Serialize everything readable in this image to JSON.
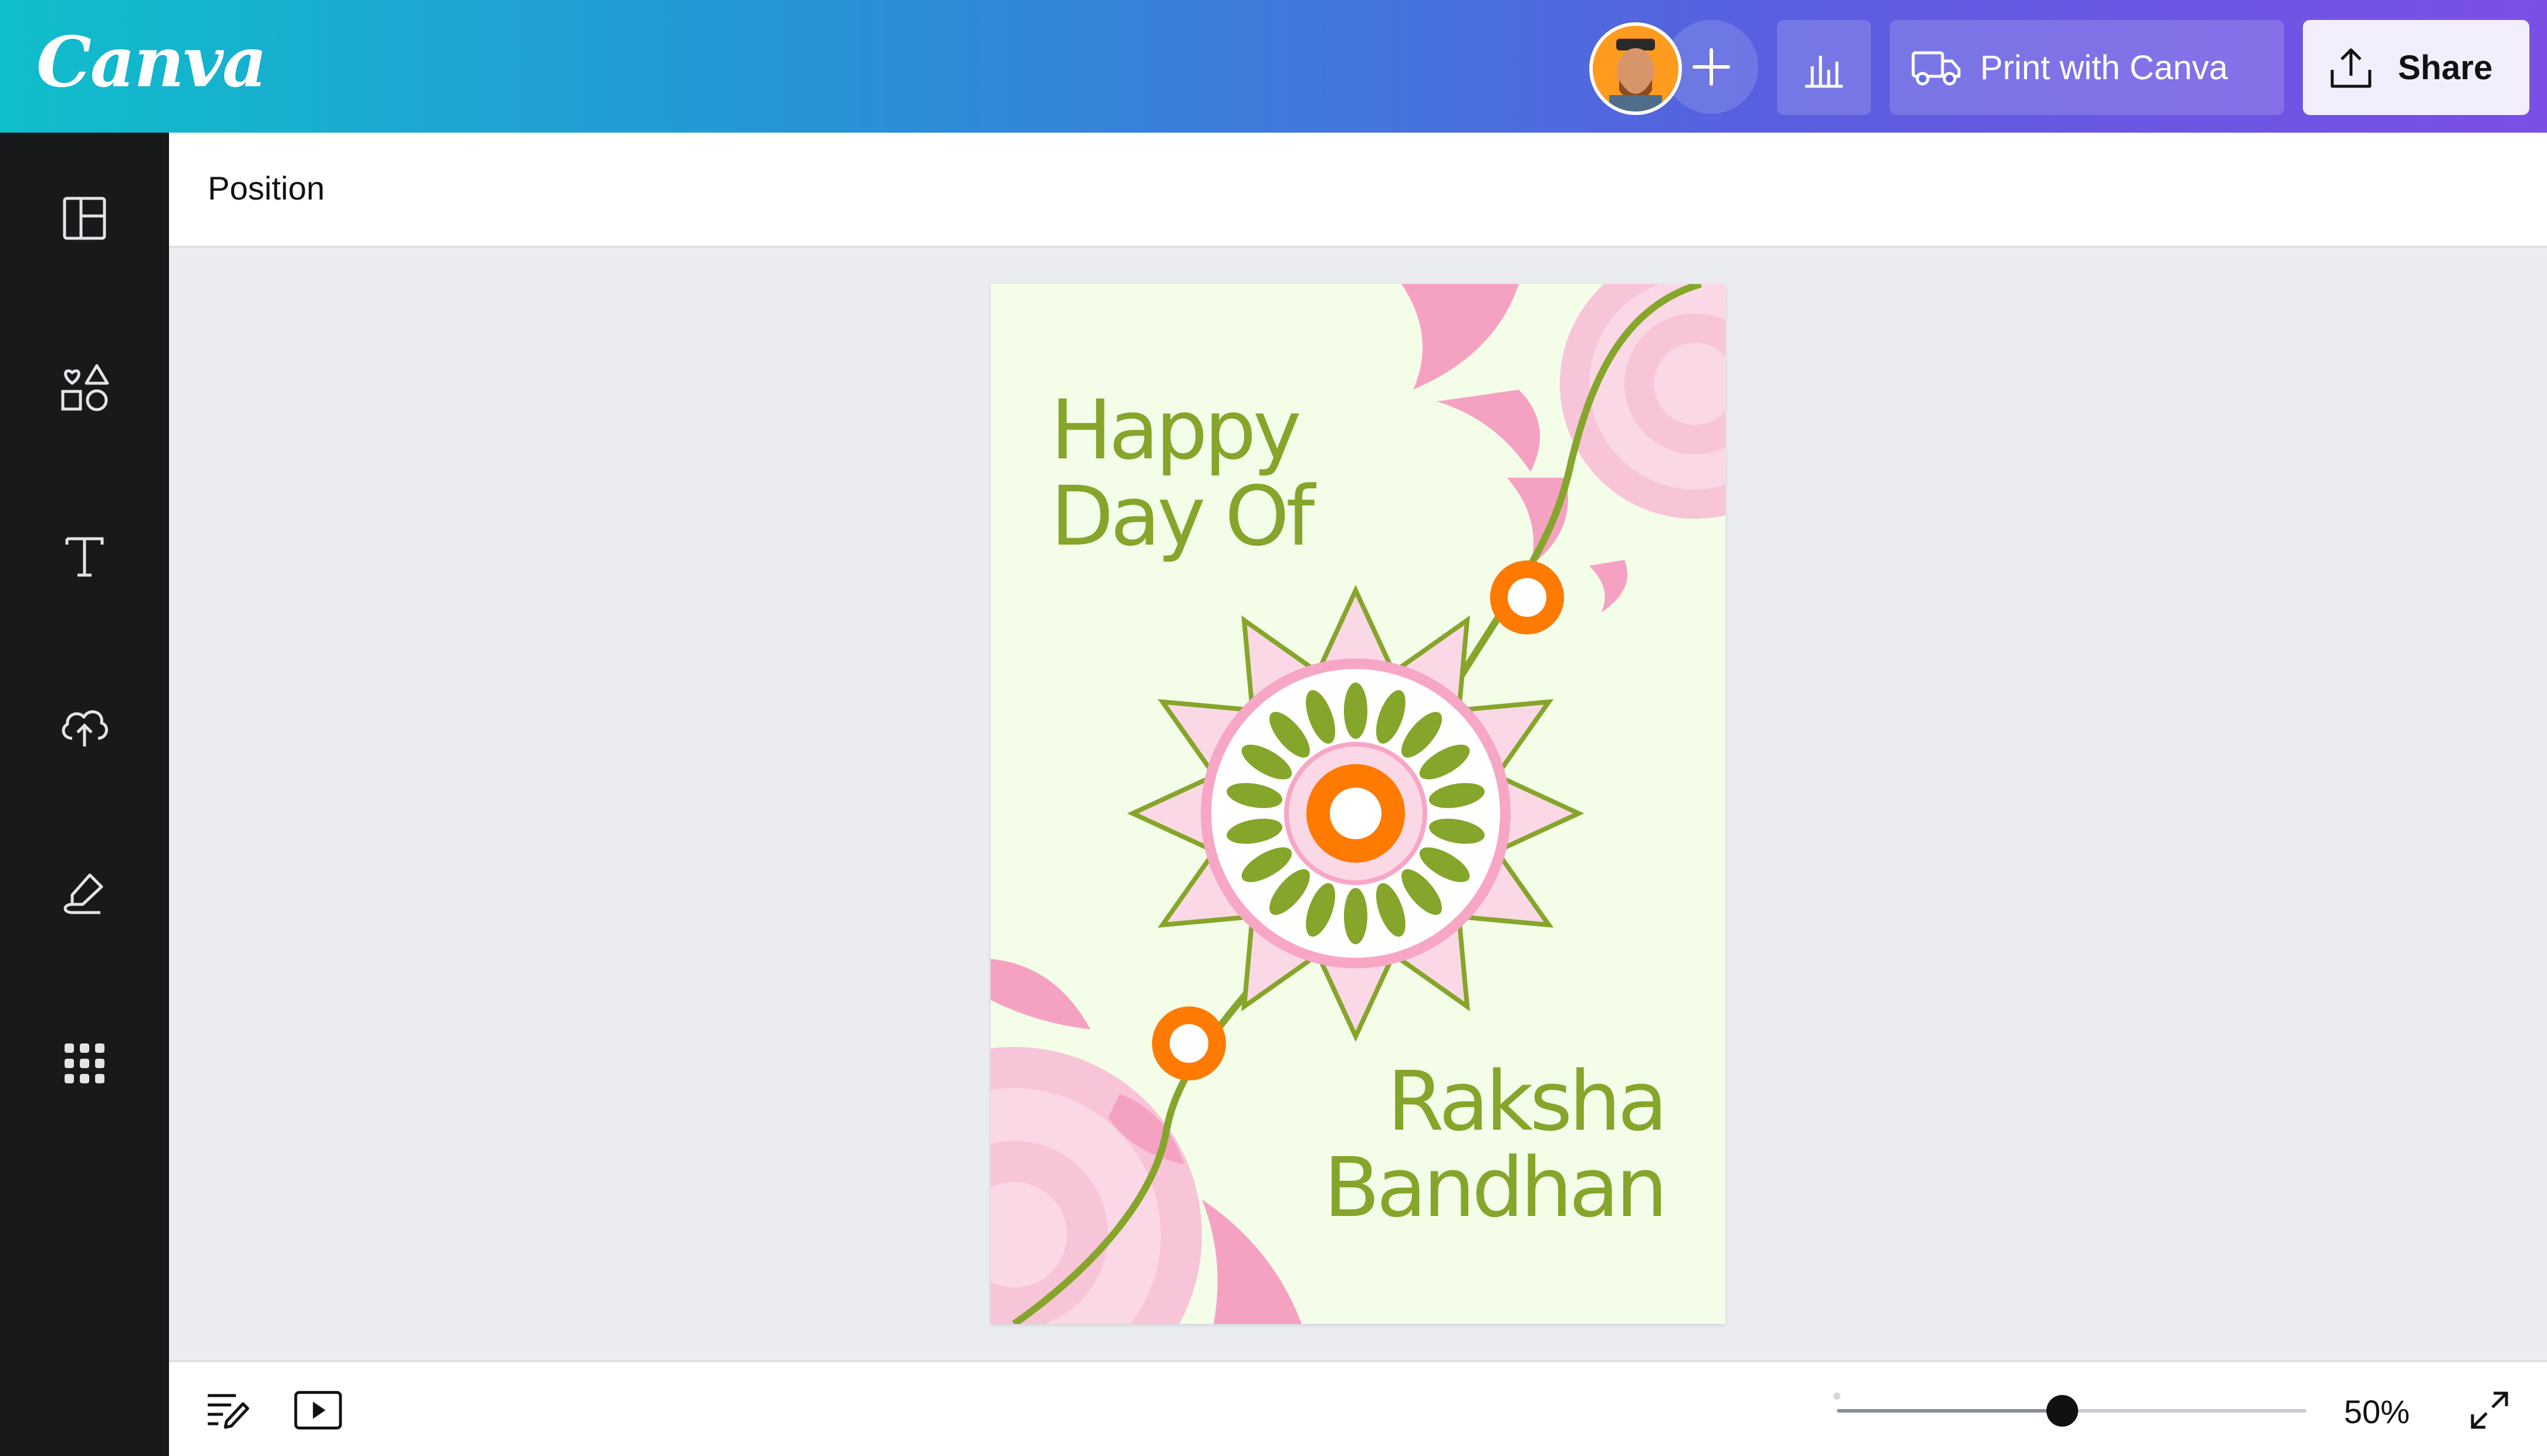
{
  "app": {
    "logo": "Canva"
  },
  "header": {
    "print_label": "Print with Canva",
    "share_label": "Share"
  },
  "toolbar": {
    "position_label": "Position"
  },
  "sidebar": {
    "items": [
      {
        "icon": "layout-icon"
      },
      {
        "icon": "elements-icon"
      },
      {
        "icon": "text-icon"
      },
      {
        "icon": "upload-cloud-icon"
      },
      {
        "icon": "draw-icon"
      },
      {
        "icon": "apps-grid-icon"
      }
    ]
  },
  "design": {
    "line1": "Happy",
    "line2": "Day Of",
    "line3": "Raksha",
    "line4": "Bandhan"
  },
  "footer": {
    "zoom_label": "50%",
    "zoom_value": 0.5
  },
  "colors": {
    "accent_green": "#86a52b",
    "pink": "#f7a6c6",
    "orange": "#ff7a00",
    "page_bg": "#f3fde8"
  }
}
